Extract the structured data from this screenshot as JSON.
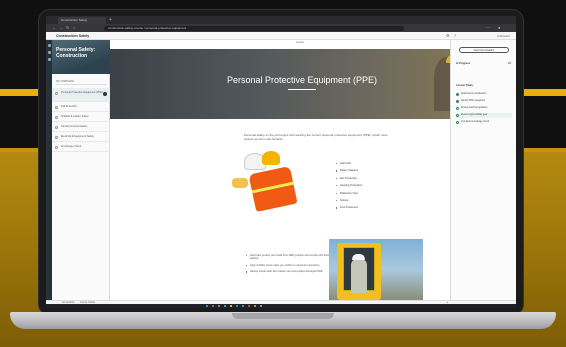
{
  "browser": {
    "tab_title": "Construction Safety",
    "new_tab_glyph": "+",
    "url": "construction-safety-course / personal-protective-equipment"
  },
  "app": {
    "title": "Construction Safety",
    "user": "Instructor"
  },
  "sidebar": {
    "course_title": "Personal Safety: Construction",
    "progress_label": "0% COMPLETE",
    "items": [
      {
        "label": "Personal Protective Equipment (PPE)",
        "active": true
      },
      {
        "label": "Fall Protection",
        "active": false
      },
      {
        "label": "Scaffold & Ladder Safety",
        "active": false
      },
      {
        "label": "Hazard Communication",
        "active": false
      },
      {
        "label": "Electrical & Equipment Safety",
        "active": false
      },
      {
        "label": "Knowledge Check",
        "active": false
      }
    ]
  },
  "main": {
    "top_label": "Lesson",
    "hero_title": "Personal Protective Equipment (PPE)",
    "intro": "Personal safety on the job begins with wearing the correct personal protective equipment (PPE), which must protect you from site hazards.",
    "ppe_items": [
      "Hard Hat",
      "Safety Glasses",
      "Ear Protection",
      "Hearing Protection",
      "Reflective Vest",
      "Gloves",
      "Foot Protection"
    ],
    "bullets": [
      "Hard hats protect your head from falling objects and impact with fixed objects.",
      "High-visibility vests make you visible to equipment operators.",
      "Always check each item before use and replace damaged PPE."
    ]
  },
  "right_panel": {
    "button_label": "New Conversation",
    "section1": "In Progress",
    "section1_count": "1/6",
    "section2": "Lesson Tasks",
    "tasks": [
      {
        "label": "Read lesson introduction",
        "done": true
      },
      {
        "label": "Identify PPE categories",
        "done": true
      },
      {
        "label": "Review hard hat guidance",
        "done": false
      },
      {
        "label": "Review high-visibility gear",
        "done": false
      },
      {
        "label": "Complete knowledge check",
        "done": false
      }
    ]
  },
  "status": {
    "left": "Accessibility",
    "middle": "Course Outline"
  },
  "colors": {
    "accent_gold": "#e7b008",
    "sidebar_hero": "#3e5663",
    "vest_orange": "#f05a14",
    "task_green": "#2e8b57"
  }
}
